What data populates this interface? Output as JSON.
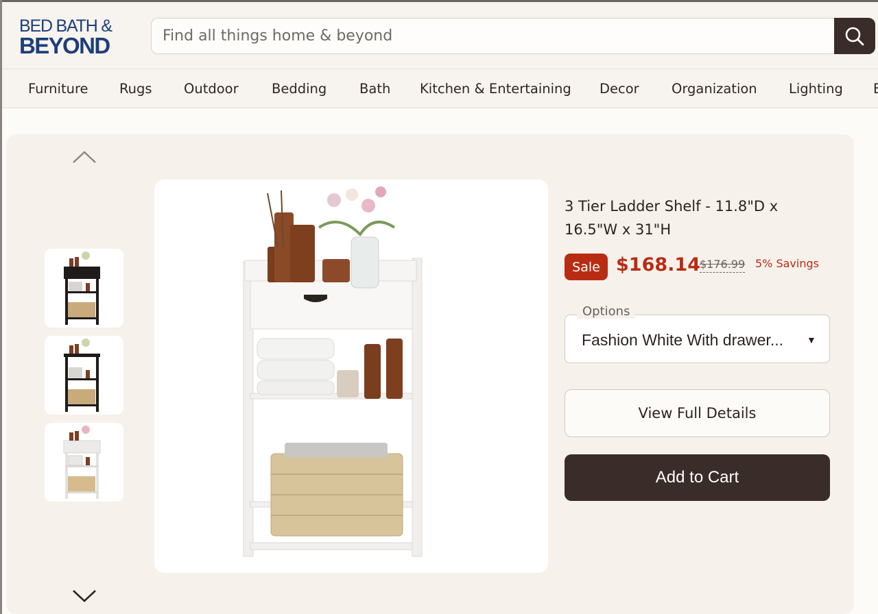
{
  "header": {
    "logo_line1": "BED BATH &",
    "logo_line2": "BEYOND",
    "search_placeholder": "Find all things home & beyond",
    "search_icon": "search-icon"
  },
  "nav": {
    "items": [
      "Furniture",
      "Rugs",
      "Outdoor",
      "Bedding",
      "Bath",
      "Kitchen & Entertaining",
      "Decor",
      "Organization",
      "Lighting",
      "B"
    ]
  },
  "gallery": {
    "up_icon": "chevron-up-icon",
    "down_icon": "chevron-down-icon",
    "thumbnails": [
      "black-shelf-thumbnail",
      "black-shelf-thumbnail",
      "white-shelf-thumbnail"
    ]
  },
  "product": {
    "title": "3 Tier Ladder Shelf - 11.8\"D x 16.5\"W x 31\"H",
    "sale_badge": "Sale",
    "price": "$168.14",
    "original_price": "$176.99",
    "savings": "5% Savings",
    "options_label": "Options",
    "options_value": "Fashion White With drawer...",
    "view_details_label": "View Full Details",
    "add_to_cart_label": "Add to Cart"
  },
  "colors": {
    "brand_blue": "#1d3f7a",
    "sale_red": "#b82c14",
    "button_dark": "#3a2c28",
    "panel_bg": "#f6f1eb"
  }
}
